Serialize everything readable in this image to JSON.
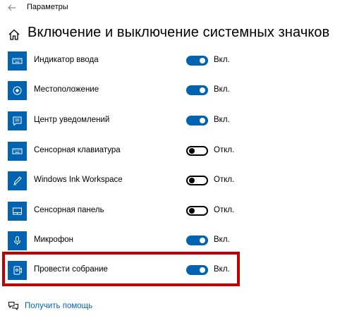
{
  "window": {
    "title": "Параметры"
  },
  "page": {
    "title": "Включение и выключение системных значков"
  },
  "items": [
    {
      "label": "Индикатор ввода",
      "state": "Вкл.",
      "on": true,
      "icon": "keyboard-icon"
    },
    {
      "label": "Местоположение",
      "state": "Вкл.",
      "on": true,
      "icon": "location-icon"
    },
    {
      "label": "Центр уведомлений",
      "state": "Вкл.",
      "on": true,
      "icon": "notification-icon"
    },
    {
      "label": "Сенсорная клавиатура",
      "state": "Откл.",
      "on": false,
      "icon": "touch-keyboard-icon"
    },
    {
      "label": "Windows Ink Workspace",
      "state": "Откл.",
      "on": false,
      "icon": "pen-icon"
    },
    {
      "label": "Сенсорная панель",
      "state": "Откл.",
      "on": false,
      "icon": "touchpad-icon"
    },
    {
      "label": "Микрофон",
      "state": "Вкл.",
      "on": true,
      "icon": "microphone-icon"
    },
    {
      "label": "Провести собрание",
      "state": "Вкл.",
      "on": true,
      "icon": "meet-now-icon"
    }
  ],
  "help": {
    "label": "Получить помощь"
  },
  "colors": {
    "accent": "#0063b1",
    "highlight": "#c00000"
  }
}
